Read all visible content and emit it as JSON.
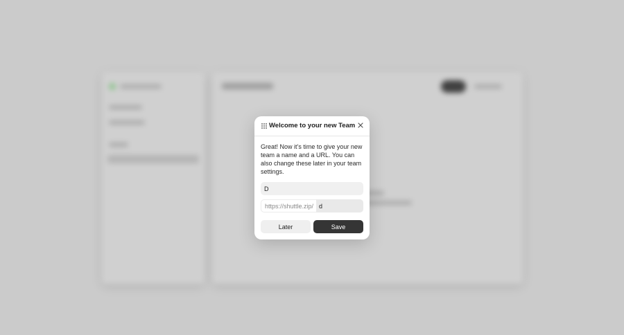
{
  "modal": {
    "title": "Welcome to your new Team",
    "description": "Great! Now it’s time to give your new team a name and a URL. You can also change these later in your team settings.",
    "team_name_value": "D",
    "url_prefix": "https://shuttle.zip/",
    "url_slug_value": "d",
    "later_label": "Later",
    "save_label": "Save"
  },
  "colors": {
    "overlay": "#cbcbcb",
    "save_button": "#353535",
    "input_bg": "#f0f0f0"
  },
  "icons": {
    "header": "grid-dots-icon",
    "close": "close-icon"
  }
}
